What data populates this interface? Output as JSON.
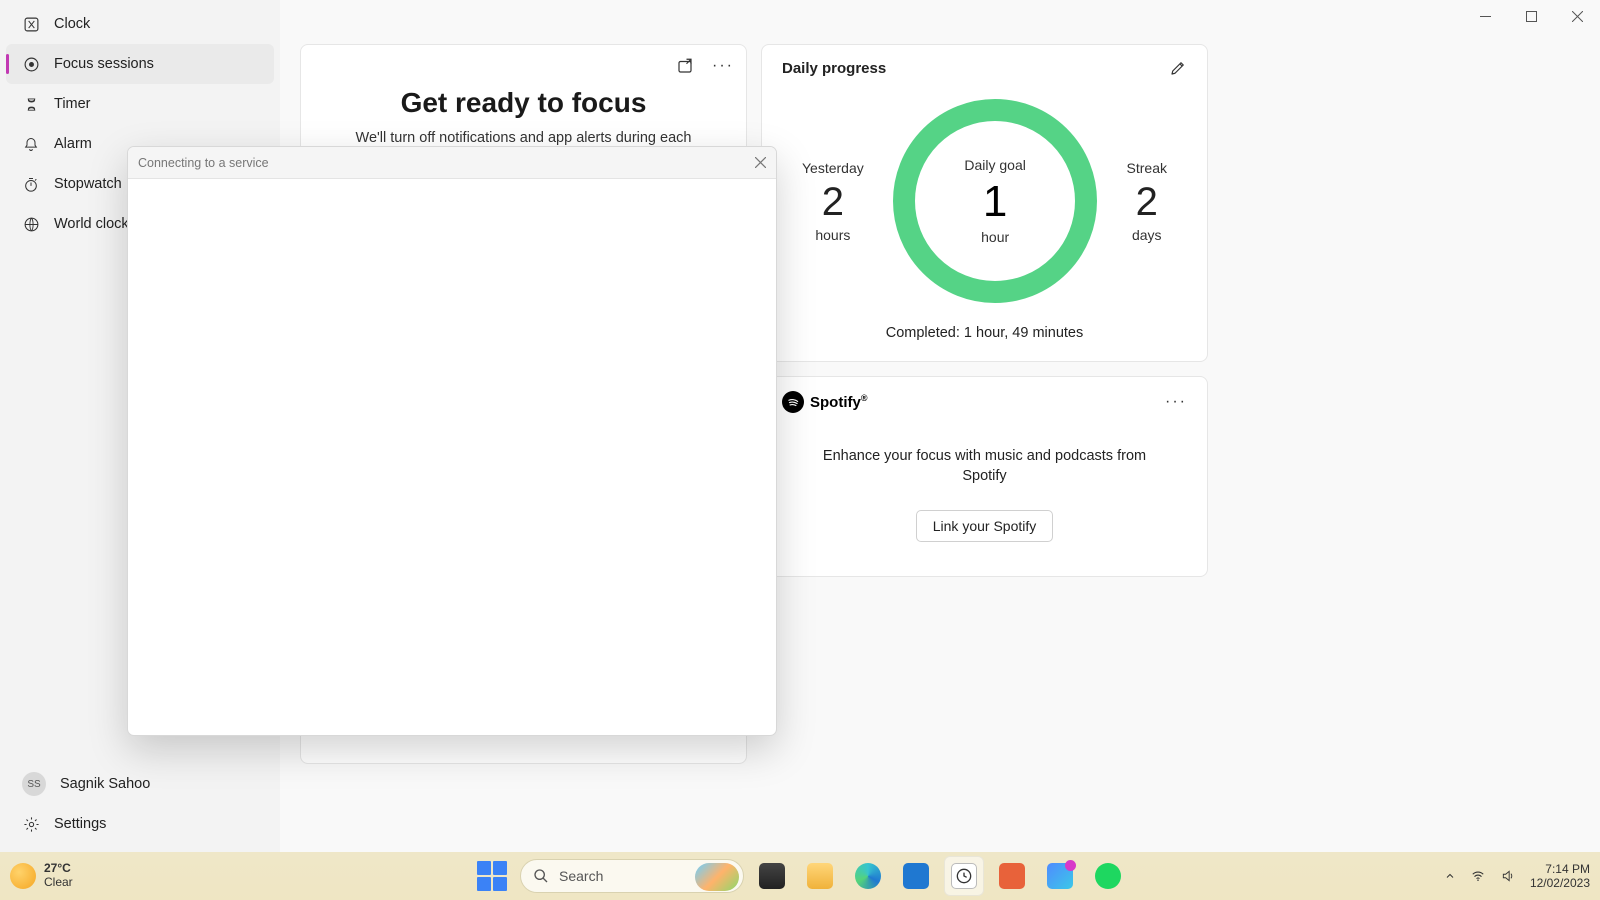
{
  "sidebar": {
    "items": [
      {
        "label": "Clock"
      },
      {
        "label": "Focus sessions"
      },
      {
        "label": "Timer"
      },
      {
        "label": "Alarm"
      },
      {
        "label": "Stopwatch"
      },
      {
        "label": "World clock"
      }
    ],
    "user_initials": "SS",
    "user_name": "Sagnik Sahoo",
    "settings_label": "Settings"
  },
  "focus": {
    "title": "Get ready to focus",
    "description": "We'll turn off notifications and app alerts during each session. For longer sessions, we'll add a short break so you can recharge."
  },
  "daily": {
    "title": "Daily progress",
    "yesterday_label": "Yesterday",
    "yesterday_value": "2",
    "yesterday_unit": "hours",
    "goal_label": "Daily goal",
    "goal_value": "1",
    "goal_unit": "hour",
    "streak_label": "Streak",
    "streak_value": "2",
    "streak_unit": "days",
    "completed": "Completed: 1 hour, 49 minutes"
  },
  "spotify": {
    "brand": "Spotify",
    "description": "Enhance your focus with music and podcasts from Spotify",
    "button": "Link your Spotify"
  },
  "dialog": {
    "title": "Connecting to a service"
  },
  "taskbar": {
    "temp": "27°C",
    "cond": "Clear",
    "search_placeholder": "Search",
    "time": "7:14 PM",
    "date": "12/02/2023"
  }
}
